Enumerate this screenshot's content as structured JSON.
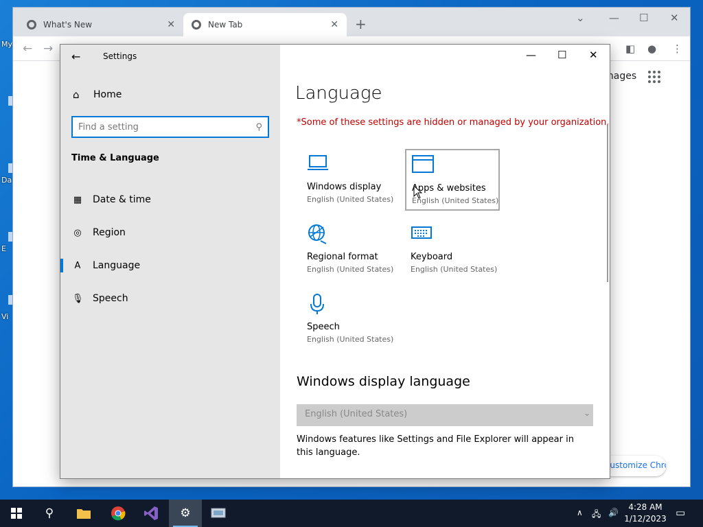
{
  "desktop": {
    "labels": [
      "My",
      "Da",
      "E",
      "Vi"
    ]
  },
  "browser": {
    "tabs": [
      {
        "title": "What's New"
      },
      {
        "title": "New Tab"
      }
    ],
    "new_tab_glyph": "+",
    "images_link": "Images",
    "customize_label": "Customize Chrome"
  },
  "settings": {
    "window_title": "Settings",
    "home_label": "Home",
    "search_placeholder": "Find a setting",
    "section_heading": "Time & Language",
    "nav": [
      {
        "label": "Date & time",
        "icon": "calendar-clock-icon"
      },
      {
        "label": "Region",
        "icon": "globe-icon"
      },
      {
        "label": "Language",
        "icon": "language-icon",
        "active": true
      },
      {
        "label": "Speech",
        "icon": "microphone-icon"
      }
    ],
    "page_title": "Language",
    "warning": "*Some of these settings are hidden or managed by your organization.",
    "tiles": [
      {
        "name": "Windows display",
        "sub": "English (United States)",
        "icon": "laptop-icon"
      },
      {
        "name": "Apps & websites",
        "sub": "English (United States)",
        "icon": "window-icon"
      },
      {
        "name": "Regional format",
        "sub": "English (United States)",
        "icon": "globe-format-icon"
      },
      {
        "name": "Keyboard",
        "sub": "English (United States)",
        "icon": "keyboard-icon"
      },
      {
        "name": "Speech",
        "sub": "English (United States)",
        "icon": "microphone-icon"
      }
    ],
    "display_language_heading": "Windows display language",
    "display_language_value": "English (United States)",
    "display_language_desc": "Windows features like Settings and File Explorer will appear in this language.",
    "accent": "#0078d7",
    "warning_color": "#c00000"
  },
  "taskbar": {
    "time": "4:28 AM",
    "date": "1/12/2023",
    "apps": [
      "start-icon",
      "search-icon",
      "file-explorer-icon",
      "chrome-icon",
      "visual-studio-icon",
      "settings-icon",
      "network-app-icon"
    ]
  }
}
